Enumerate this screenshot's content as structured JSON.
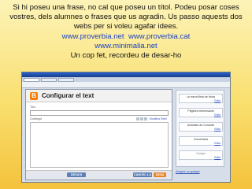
{
  "caption": {
    "line1": "Si hi poseu una frase, no cal que poseu un títol. Podeu posar coses",
    "line2": "vostres, dels alumnes o frases que us agradin. Us passo aquests dos",
    "line3": "webs per si voleu agafar idees.",
    "link1": "www.proverbia.net",
    "link2": "www.proverbia.cat",
    "link3": "www.minimalia.net",
    "line5": "Un cop fet, recordeu de desar-ho"
  },
  "screenshot": {
    "dialog_title": "Configurar el text",
    "title_label": "Títol",
    "content_label": "Contingut",
    "rich_text_link": "Modifica l'html",
    "buttons": {
      "desa": "DESA'N",
      "cancel": "CANCEL·LA",
      "save": "DESA"
    },
    "layout_boxes": [
      {
        "title": "La meva llista de blocs",
        "edit": "Edita"
      },
      {
        "title": "Pàgines interessants",
        "edit": "Edita"
      },
      {
        "title": "Activitats de Conselló",
        "edit": "Edita"
      },
      {
        "title": "Comentaris",
        "edit": "Edita"
      },
      {
        "title": "Gadget",
        "edit": "Edita"
      }
    ],
    "add_gadget": "Afegeix un gadget"
  }
}
